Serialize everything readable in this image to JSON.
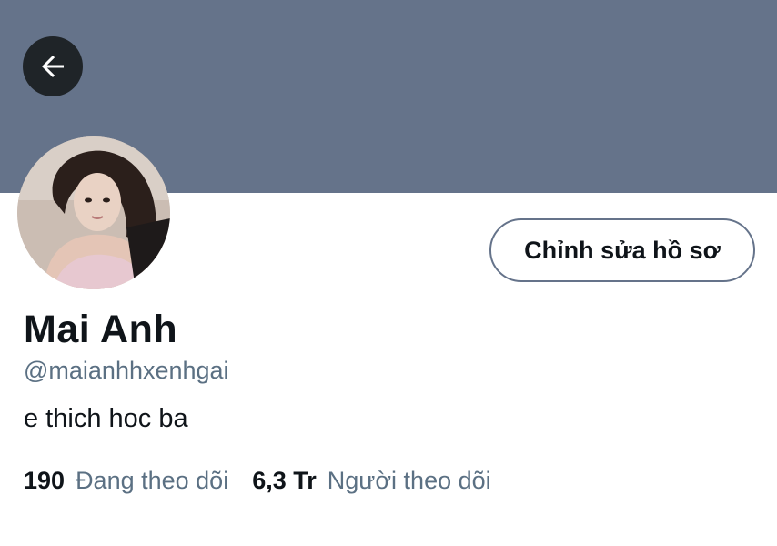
{
  "header": {
    "banner_color": "#65738a",
    "back_icon": "arrow-left-icon"
  },
  "profile": {
    "name": "Mai Anh",
    "handle": "@maianhhxenhgai",
    "bio": "e thich hoc ba",
    "edit_button_label": "Chỉnh sửa hồ sơ"
  },
  "stats": {
    "following_count": "190",
    "following_label": "Đang theo dõi",
    "followers_count": "6,3 Tr",
    "followers_label": "Người theo dõi"
  },
  "colors": {
    "text_primary": "#0f1419",
    "text_secondary": "#5b7083",
    "back_button_bg": "#1f2428"
  }
}
